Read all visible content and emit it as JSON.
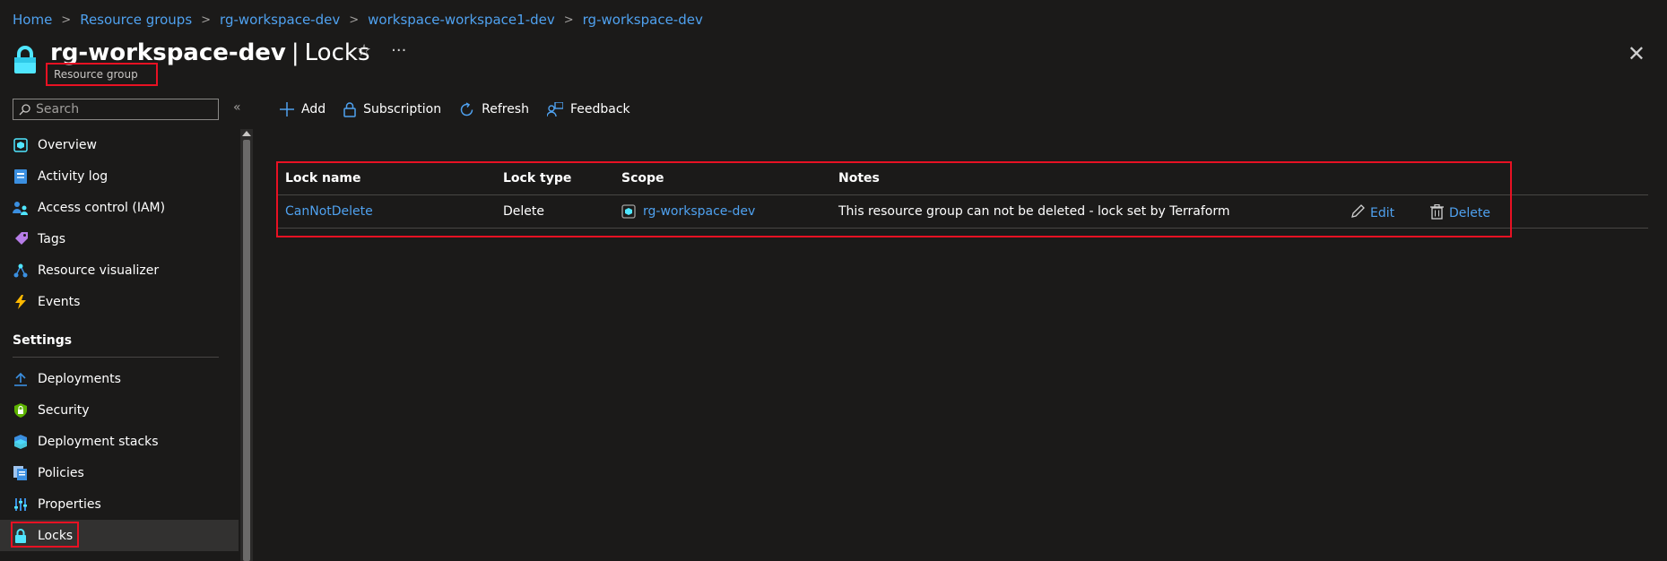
{
  "breadcrumb": [
    "Home",
    "Resource groups",
    "rg-workspace-dev",
    "workspace-workspace1-dev",
    "rg-workspace-dev"
  ],
  "header": {
    "title": "rg-workspace-dev",
    "separator": "|",
    "page": "Locks",
    "subtitle": "Resource group",
    "favorite_icon": "star-icon",
    "more_icon": "ellipsis-icon",
    "close_icon": "close-icon"
  },
  "sidebar": {
    "search_placeholder": "Search",
    "collapse_label": "«",
    "items": [
      {
        "label": "Overview",
        "icon": "resource-group-icon"
      },
      {
        "label": "Activity log",
        "icon": "activity-log-icon"
      },
      {
        "label": "Access control (IAM)",
        "icon": "iam-icon"
      },
      {
        "label": "Tags",
        "icon": "tag-icon"
      },
      {
        "label": "Resource visualizer",
        "icon": "visualizer-icon"
      },
      {
        "label": "Events",
        "icon": "lightning-icon"
      }
    ],
    "settings_header": "Settings",
    "settings_items": [
      {
        "label": "Deployments",
        "icon": "deployments-icon"
      },
      {
        "label": "Security",
        "icon": "shield-icon"
      },
      {
        "label": "Deployment stacks",
        "icon": "stacks-icon"
      },
      {
        "label": "Policies",
        "icon": "policies-icon"
      },
      {
        "label": "Properties",
        "icon": "properties-icon"
      },
      {
        "label": "Locks",
        "icon": "lock-icon"
      }
    ]
  },
  "toolbar": {
    "add": "Add",
    "subscription": "Subscription",
    "refresh": "Refresh",
    "feedback": "Feedback"
  },
  "table": {
    "headers": [
      "Lock name",
      "Lock type",
      "Scope",
      "Notes"
    ],
    "rows": [
      {
        "name": "CanNotDelete",
        "type": "Delete",
        "scope": "rg-workspace-dev",
        "notes": "This resource group can not be deleted - lock set by Terraform",
        "edit": "Edit",
        "delete": "Delete"
      }
    ]
  },
  "colors": {
    "background": "#1b1a19",
    "link": "#4fa1ef",
    "highlight": "#e81123",
    "active_nav": "#323130"
  }
}
